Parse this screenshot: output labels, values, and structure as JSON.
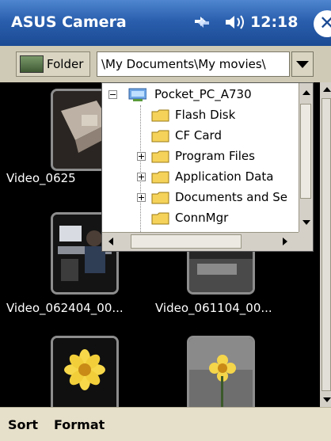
{
  "titlebar": {
    "app_title": "ASUS Camera",
    "clock": "12:18",
    "icons": [
      "signal-icon",
      "volume-icon",
      "close-icon"
    ],
    "close_symbol": "✕"
  },
  "toolbar": {
    "folder_button": "Folder",
    "path": "\\My Documents\\My movies\\"
  },
  "gallery": {
    "items": [
      {
        "caption": "Video_0625"
      },
      {
        "caption": "Video_062404_00..."
      },
      {
        "caption": "Video_061104_00..."
      },
      {
        "caption": ""
      },
      {
        "caption": ""
      }
    ]
  },
  "folder_tree": {
    "root": "Pocket_PC_A730",
    "items": [
      {
        "label": "Flash Disk",
        "expander": "none"
      },
      {
        "label": "CF Card",
        "expander": "none"
      },
      {
        "label": "Program Files",
        "expander": "plus"
      },
      {
        "label": "Application Data",
        "expander": "plus"
      },
      {
        "label": "Documents and Se",
        "expander": "plus"
      },
      {
        "label": "ConnMgr",
        "expander": "none"
      }
    ]
  },
  "menubar": {
    "sort": "Sort",
    "format": "Format"
  },
  "colors": {
    "title_bar": "#2a5fae",
    "toolbar": "#cfcab5",
    "menubar": "#e6dfc9",
    "gallery_bg": "#000000",
    "folder_yellow": "#f5d35a"
  }
}
